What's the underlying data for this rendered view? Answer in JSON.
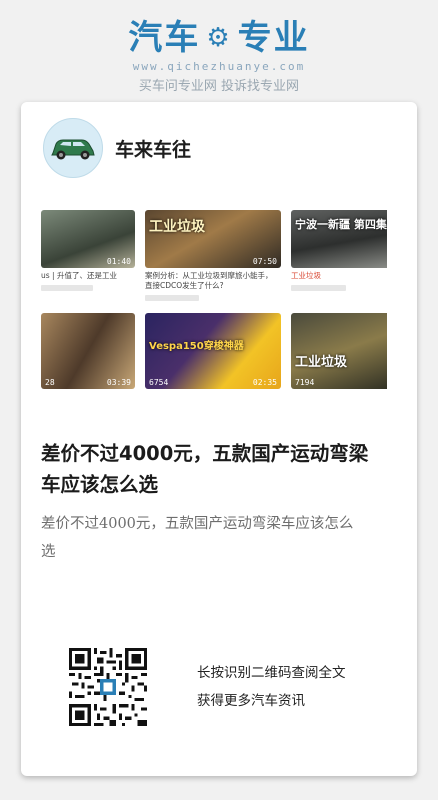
{
  "brand": {
    "title_left": "汽车",
    "title_right": "专业",
    "url": "www.qichezhuanye.com",
    "slogan": "买车问专业网 投诉找专业网",
    "accent_color": "#2a7fb6"
  },
  "author": {
    "name": "车来车往",
    "avatar_icon": "car-icon"
  },
  "thumbs": {
    "row1": [
      {
        "tag": "",
        "duration": "01:40",
        "caption": "us | 升值了、还是工业",
        "highlight": ""
      },
      {
        "tag": "工业垃圾",
        "duration": "07:50",
        "caption": "案例分析：从工业垃圾到摩旅小能手，",
        "caption2": "直接CDCO发生了什么?",
        "highlight": "工业垃圾"
      },
      {
        "tag": "宁波一新疆 第四集",
        "duration": "",
        "caption": "工业垃圾",
        "highlight": "工业垃圾"
      }
    ],
    "row2": [
      {
        "tag": "",
        "stat": "28",
        "duration": "03:39"
      },
      {
        "tag": "Vespa150穿梭神器",
        "stat": "6754",
        "duration": "02:35"
      },
      {
        "tag": "工业垃圾",
        "stat": "7194",
        "duration": ""
      }
    ]
  },
  "article": {
    "headline": "差价不过4000元，五款国产运动弯梁车应该怎么选",
    "summary": "差价不过4000元，五款国产运动弯梁车应该怎么选"
  },
  "qr": {
    "line1": "长按识别二维码查阅全文",
    "line2": "获得更多汽车资讯"
  }
}
